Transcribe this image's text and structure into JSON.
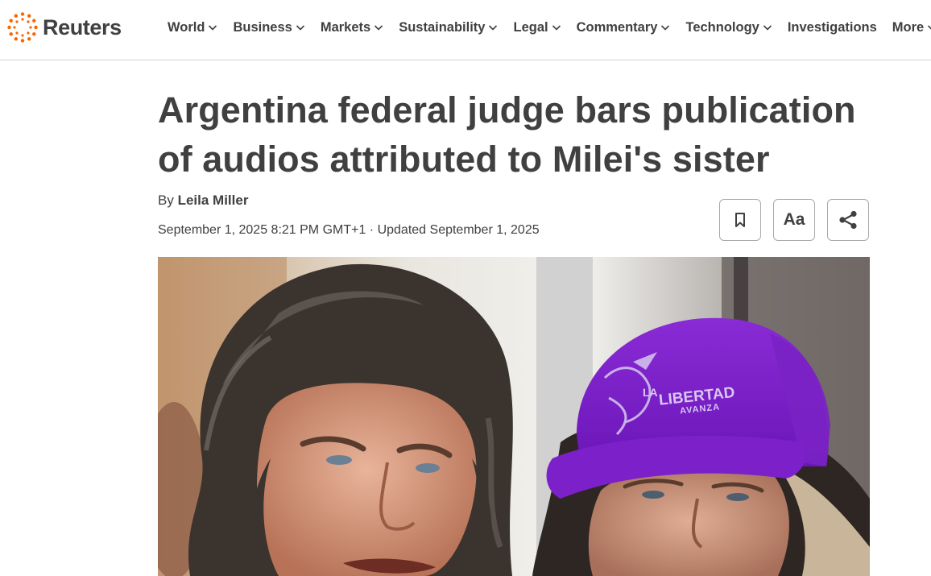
{
  "site": {
    "brand": "Reuters",
    "colors": {
      "brand_orange": "#fa6400",
      "text": "#404040",
      "border": "#d4d4d4"
    }
  },
  "nav": {
    "items": [
      {
        "label": "World",
        "dropdown": true
      },
      {
        "label": "Business",
        "dropdown": true
      },
      {
        "label": "Markets",
        "dropdown": true
      },
      {
        "label": "Sustainability",
        "dropdown": true
      },
      {
        "label": "Legal",
        "dropdown": true
      },
      {
        "label": "Commentary",
        "dropdown": true
      },
      {
        "label": "Technology",
        "dropdown": true
      },
      {
        "label": "Investigations",
        "dropdown": false
      },
      {
        "label": "More",
        "dropdown": true
      }
    ]
  },
  "article": {
    "headline_line1": "Argentina federal judge bars publication",
    "headline_line2": "of audios attributed to Milei's sister",
    "byline_prefix": "By",
    "author": "Leila Miller",
    "dateline": "September 1, 2025 8:21 PM GMT+1 · Updated September 1, 2025",
    "tools": [
      {
        "name": "bookmark",
        "icon": "bookmark-icon"
      },
      {
        "name": "text-size",
        "label": "Aa"
      },
      {
        "name": "share",
        "icon": "share-icon"
      }
    ]
  },
  "photo": {
    "cap_text_line1": "LA",
    "cap_text_line2": "LIBERTAD",
    "cap_text_line3": "AVANZA"
  }
}
